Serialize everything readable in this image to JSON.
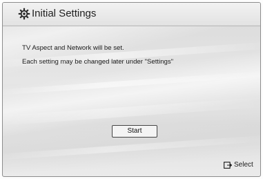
{
  "header": {
    "title": "Initial Settings",
    "icon": "gear-icon"
  },
  "body": {
    "line1": "TV Aspect and Network will be set.",
    "line2": "Each setting may be changed later under \"Settings\""
  },
  "actions": {
    "start_label": "Start"
  },
  "footer": {
    "select_label": "Select",
    "select_icon": "enter-key-icon"
  }
}
